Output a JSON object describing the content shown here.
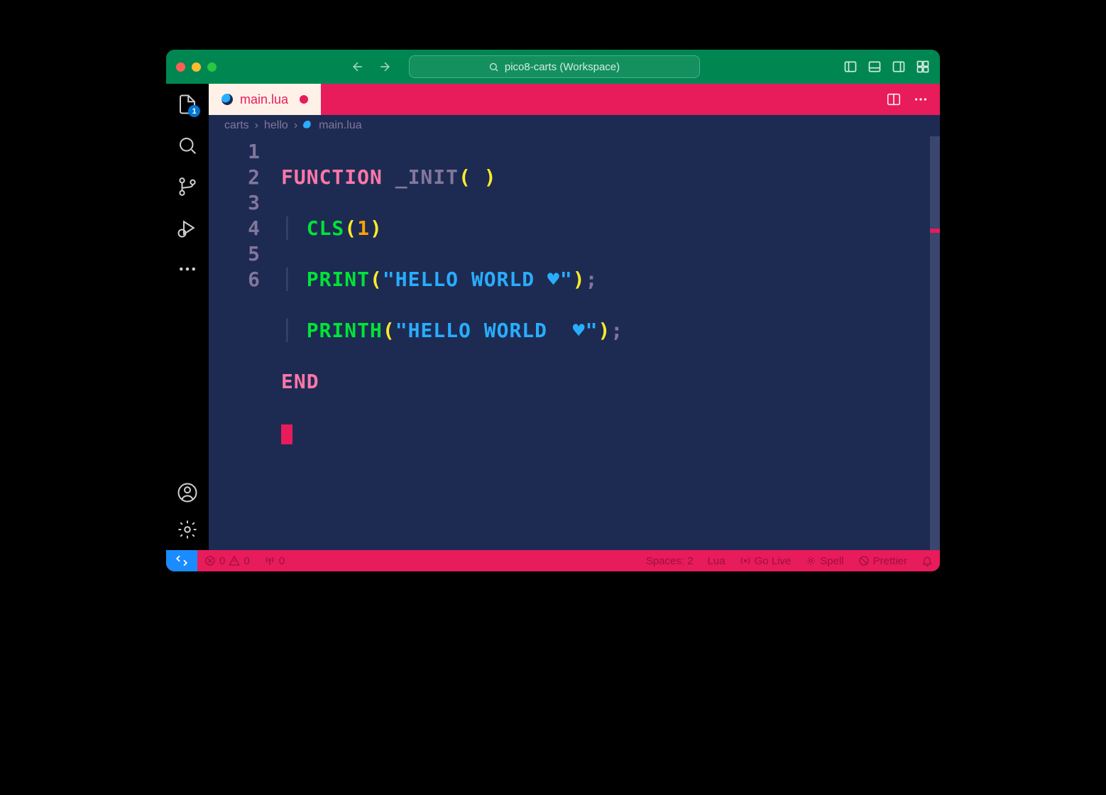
{
  "titlebar": {
    "search_text": "pico8-carts (Workspace)"
  },
  "activitybar": {
    "explorer_badge": "1"
  },
  "tab": {
    "filename": "main.lua"
  },
  "breadcrumb": {
    "parts": [
      "carts",
      "hello",
      "main.lua"
    ]
  },
  "code": {
    "line_numbers": [
      "1",
      "2",
      "3",
      "4",
      "5",
      "6"
    ],
    "l1": {
      "kw": "FUNCTION",
      "id": "_INIT",
      "op": "(",
      "cp": ")"
    },
    "l2": {
      "fn": "CLS",
      "op": "(",
      "arg": "1",
      "cp": ")"
    },
    "l3": {
      "fn": "PRINT",
      "op": "(",
      "str": "\"HELLO WORLD ♥\"",
      "cp": ")",
      "sc": ";"
    },
    "l4": {
      "fn": "PRINTH",
      "op": "(",
      "str": "\"HELLO WORLD  ♥\"",
      "cp": ")",
      "sc": ";"
    },
    "l5": {
      "kw": "END"
    }
  },
  "statusbar": {
    "errors": "0",
    "warnings": "0",
    "ports": "0",
    "spaces": "Spaces: 2",
    "lang": "Lua",
    "golive": "Go Live",
    "spell": "Spell",
    "prettier": "Prettier"
  }
}
